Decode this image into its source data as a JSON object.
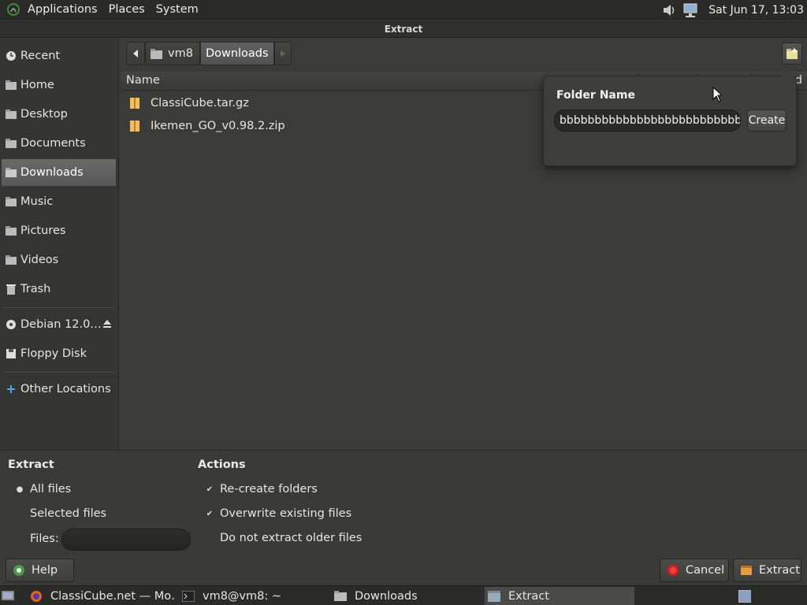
{
  "top_panel": {
    "menus": [
      "Applications",
      "Places",
      "System"
    ],
    "clock": "Sat Jun 17, 13:03",
    "icons": [
      "gnome-foot-icon",
      "volume-icon",
      "network-icon"
    ]
  },
  "window": {
    "title": "Extract"
  },
  "sidebar": {
    "items": [
      {
        "label": "Recent",
        "icon": "clock-icon"
      },
      {
        "label": "Home",
        "icon": "home-folder-icon"
      },
      {
        "label": "Desktop",
        "icon": "folder-icon"
      },
      {
        "label": "Documents",
        "icon": "folder-icon"
      },
      {
        "label": "Downloads",
        "icon": "folder-icon",
        "selected": true
      },
      {
        "label": "Music",
        "icon": "folder-icon"
      },
      {
        "label": "Pictures",
        "icon": "folder-icon"
      },
      {
        "label": "Videos",
        "icon": "folder-icon"
      },
      {
        "label": "Trash",
        "icon": "trash-icon"
      }
    ],
    "devices": [
      {
        "label": "Debian 12.0…",
        "icon": "disc-icon",
        "eject": true
      },
      {
        "label": "Floppy Disk",
        "icon": "floppy-icon"
      }
    ],
    "other": {
      "label": "Other Locations",
      "icon": "plus-icon"
    }
  },
  "pathbar": {
    "segments": [
      "vm8",
      "Downloads"
    ]
  },
  "file_list": {
    "column_name": "Name",
    "column_tail": "d",
    "files": [
      "ClassiCube.tar.gz",
      "Ikemen_GO_v0.98.2.zip"
    ]
  },
  "popover": {
    "label": "Folder Name",
    "value": "bbbbbbbbbbbbbbbbbbbbbbbbbbbbbb",
    "create_label": "Create"
  },
  "extract_options": {
    "extract_title": "Extract",
    "all_files": "All files",
    "selected_files": "Selected files",
    "files": "Files:",
    "actions_title": "Actions",
    "recreate_folders": "Re-create folders",
    "overwrite": "Overwrite existing files",
    "no_older": "Do not extract older files"
  },
  "buttons": {
    "help": "Help",
    "cancel": "Cancel",
    "extract": "Extract"
  },
  "taskbar": {
    "tasks": [
      {
        "label": "ClassiCube.net — Mo…",
        "icon": "firefox-icon"
      },
      {
        "label": "vm8@vm8: ~",
        "icon": "terminal-icon"
      },
      {
        "label": "Downloads",
        "icon": "folder-icon"
      },
      {
        "label": "Extract",
        "icon": "archive-icon",
        "active": true
      }
    ]
  },
  "colors": {
    "accent_selected": "#5e5e5d",
    "background": "#3a3a39",
    "cancel_red": "#d42020"
  }
}
